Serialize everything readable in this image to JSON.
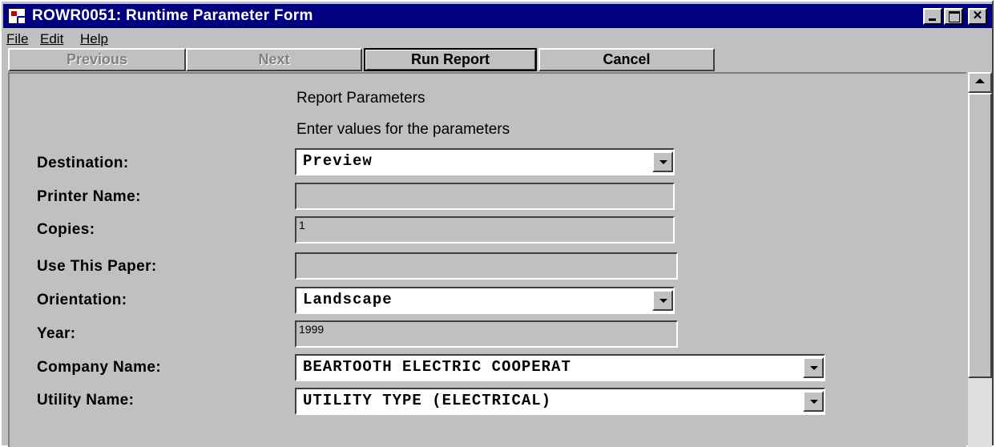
{
  "window": {
    "title": "ROWR0051: Runtime Parameter Form",
    "min_glyph": "",
    "max_glyph": "",
    "close_glyph": "✕"
  },
  "menu": [
    {
      "label": "File"
    },
    {
      "label": "Edit"
    },
    {
      "label": "Help"
    }
  ],
  "toolbar": {
    "previous_label": "Previous",
    "next_label": "Next",
    "run_label": "Run Report",
    "cancel_label": "Cancel"
  },
  "form": {
    "heading": "Report Parameters",
    "instructions": "Enter values for the parameters",
    "fields": [
      {
        "label": "Destination:",
        "value": "Preview"
      },
      {
        "label": "Printer Name:",
        "value": ""
      },
      {
        "label": "Copies:",
        "value": "1"
      },
      {
        "label": "Use This Paper:",
        "value": ""
      },
      {
        "label": "Orientation:",
        "value": "Landscape"
      },
      {
        "label": "Year:",
        "value": "1999"
      },
      {
        "label": "Company Name:",
        "value": "BEARTOOTH ELECTRIC COOPERAT"
      },
      {
        "label": "Utility Name:",
        "value": "UTILITY TYPE (ELECTRICAL)"
      }
    ]
  },
  "icons": {
    "app": "app-icon",
    "dropdown": "chevron-down-icon",
    "scroll_up": "scroll-up-arrow-icon"
  }
}
